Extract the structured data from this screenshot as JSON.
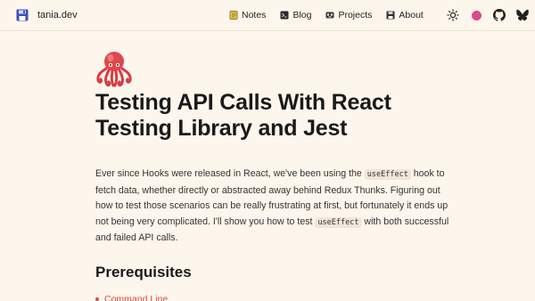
{
  "header": {
    "site_name": "tania.dev",
    "nav": [
      {
        "label": "Notes",
        "icon": "notebook-icon"
      },
      {
        "label": "Blog",
        "icon": "terminal-icon"
      },
      {
        "label": "Projects",
        "icon": "robot-icon"
      },
      {
        "label": "About",
        "icon": "floppy-icon"
      }
    ],
    "tools": [
      "theme-toggle-icon",
      "color-dot",
      "github-icon",
      "bluesky-icon"
    ],
    "accent_color": "#d84b8a"
  },
  "article": {
    "title": "Testing API Calls With React Testing Library and Jest",
    "intro": {
      "p1": "Ever since Hooks were released in React, we've been using the ",
      "code1": "useEffect",
      "p2": " hook to fetch data, whether directly or abstracted away behind Redux Thunks. Figuring out how to test those scenarios can be really frustrating at first, but fortunately it ends up not being very complicated. I'll show you how to test ",
      "code2": "useEffect",
      "p3": " with both successful and failed API calls."
    },
    "section_heading": "Prerequisites",
    "list_first": "Command Line"
  }
}
